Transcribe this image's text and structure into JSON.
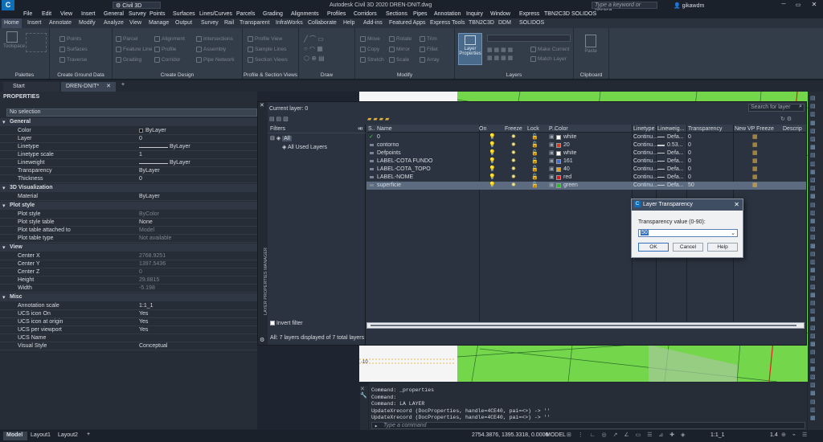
{
  "title_bar": {
    "workspace": "Civil 3D",
    "app_title": "Autodesk Civil 3D 2020   DREN-DNIT.dwg",
    "search_placeholder": "Type a keyword or phrase",
    "user": "gikawdm"
  },
  "menu_items": [
    "File",
    "Edit",
    "View",
    "Insert",
    "General",
    "Survey",
    "Points",
    "Surfaces",
    "Lines/Curves",
    "Parcels",
    "Grading",
    "Alignments",
    "Profiles",
    "Corridors",
    "Sections",
    "Pipes",
    "Annotation",
    "Inquiry",
    "Window",
    "Express",
    "TBN2C3D",
    "SOLIDOS"
  ],
  "ribbon_tabs": [
    "Home",
    "Insert",
    "Annotate",
    "Modify",
    "Analyze",
    "View",
    "Manage",
    "Output",
    "Survey",
    "Rail",
    "Transparent",
    "InfraWorks",
    "Collaborate",
    "Help",
    "Add-ins",
    "Featured Apps",
    "Express Tools",
    "TBN2C3D",
    "DDM",
    "SOLIDOS"
  ],
  "ribbon": {
    "toolspace": "Toolspace",
    "ground_items": [
      "Points",
      "Surfaces",
      "Traverse"
    ],
    "design_items": [
      "Parcel",
      "Feature Line",
      "Grading",
      "Alignment",
      "Profile",
      "Corridor",
      "Intersections",
      "Assembly",
      "Pipe Network"
    ],
    "profile_items": [
      "Profile View",
      "Sample Lines",
      "Section Views"
    ],
    "modify_items": [
      "Move",
      "Rotate",
      "Trim",
      "Copy",
      "Mirror",
      "Fillet",
      "Stretch",
      "Scale",
      "Array"
    ],
    "layer_props": "Layer Properties",
    "layers_items": [
      "Make Current",
      "Match Layer"
    ],
    "paste": "Paste",
    "panels": [
      "Palettes",
      "Create Ground Data",
      "Create Design",
      "Profile & Section Views",
      "Draw",
      "Modify",
      "Layers",
      "Clipboard"
    ]
  },
  "doc_tabs": [
    "Start",
    "DREN-DNIT*"
  ],
  "properties": {
    "title": "PROPERTIES",
    "selection": "No selection",
    "groups": [
      {
        "name": "General",
        "rows": [
          [
            "Color",
            "ByLayer"
          ],
          [
            "Layer",
            "0"
          ],
          [
            "Linetype",
            "ByLayer"
          ],
          [
            "Linetype scale",
            "1"
          ],
          [
            "Lineweight",
            "ByLayer"
          ],
          [
            "Transparency",
            "ByLayer"
          ],
          [
            "Thickness",
            "0"
          ]
        ]
      },
      {
        "name": "3D Visualization",
        "rows": [
          [
            "Material",
            "ByLayer"
          ]
        ]
      },
      {
        "name": "Plot style",
        "rows": [
          [
            "Plot style",
            "ByColor"
          ],
          [
            "Plot style table",
            "None"
          ],
          [
            "Plot table attached to",
            "Model"
          ],
          [
            "Plot table type",
            "Not available"
          ]
        ]
      },
      {
        "name": "View",
        "rows": [
          [
            "Center X",
            "2768.9251"
          ],
          [
            "Center Y",
            "1397.5436"
          ],
          [
            "Center Z",
            "0"
          ],
          [
            "Height",
            "29.8815"
          ],
          [
            "Width",
            "-5.198"
          ]
        ]
      },
      {
        "name": "Misc",
        "rows": [
          [
            "Annotation scale",
            "1:1_1"
          ],
          [
            "UCS icon On",
            "Yes"
          ],
          [
            "UCS icon at origin",
            "Yes"
          ],
          [
            "UCS per viewport",
            "Yes"
          ],
          [
            "UCS Name",
            ""
          ],
          [
            "Visual Style",
            "Conceptual"
          ]
        ]
      }
    ]
  },
  "layer_manager": {
    "current_layer": "Current layer: 0",
    "search_placeholder": "Search for layer",
    "filters_label": "Filters",
    "filter_all": "All",
    "filter_used": "All Used Layers",
    "invert_filter": "Invert filter",
    "status": "All: 7 layers displayed of 7 total layers",
    "side_title": "LAYER PROPERTIES MANAGER",
    "columns": [
      "S..",
      "Name",
      "On",
      "Freeze",
      "Lock",
      "P..",
      "Color",
      "Linetype",
      "Lineweig...",
      "Transparency",
      "New VP Freeze",
      "Descrip"
    ],
    "layers": [
      {
        "name": "0",
        "color": "white",
        "hex": "#ffffff",
        "linetype": "Continu...",
        "lineweight": "Defa...",
        "transparency": "0"
      },
      {
        "name": "contorno",
        "color": "20",
        "hex": "#d83a1a",
        "linetype": "Continu...",
        "lineweight": "0.53...",
        "transparency": "0"
      },
      {
        "name": "Defpoints",
        "color": "white",
        "hex": "#ffffff",
        "linetype": "Continu...",
        "lineweight": "Defa...",
        "transparency": "0"
      },
      {
        "name": "LABEL-COTA FUNDO",
        "color": "161",
        "hex": "#3d6fd6",
        "linetype": "Continu...",
        "lineweight": "Defa...",
        "transparency": "0"
      },
      {
        "name": "LABEL-COTA_TOPO",
        "color": "40",
        "hex": "#e6a21a",
        "linetype": "Continu...",
        "lineweight": "Defa...",
        "transparency": "0"
      },
      {
        "name": "LABEL-NOME",
        "color": "red",
        "hex": "#e01818",
        "linetype": "Continu...",
        "lineweight": "Defa...",
        "transparency": "0"
      },
      {
        "name": "superficie",
        "color": "green",
        "hex": "#22c022",
        "linetype": "Continu...",
        "lineweight": "Defa...",
        "transparency": "50"
      }
    ]
  },
  "dialog": {
    "title": "Layer Transparency",
    "prompt": "Transparency value (0-90):",
    "value": "50",
    "ok": "OK",
    "cancel": "Cancel",
    "help": "Help"
  },
  "viewport": {
    "axis_label": "-10"
  },
  "command_lines": [
    "Command: _properties",
    "Command:",
    "Command: LA LAYER",
    "UpdateXrecord (DocProperties, handle=4CE40, pai=<>) -> ''",
    "UpdateXrecord (DocProperties, handle=4CE40, pai=<>) -> ''"
  ],
  "command_placeholder": "Type a command",
  "status_bar": {
    "tabs": [
      "Model",
      "Layout1",
      "Layout2"
    ],
    "coords": "2754.3876, 1395.3318, 0.0000",
    "model": "MODEL",
    "scale": "1:1_1",
    "zoom": "1.4"
  }
}
